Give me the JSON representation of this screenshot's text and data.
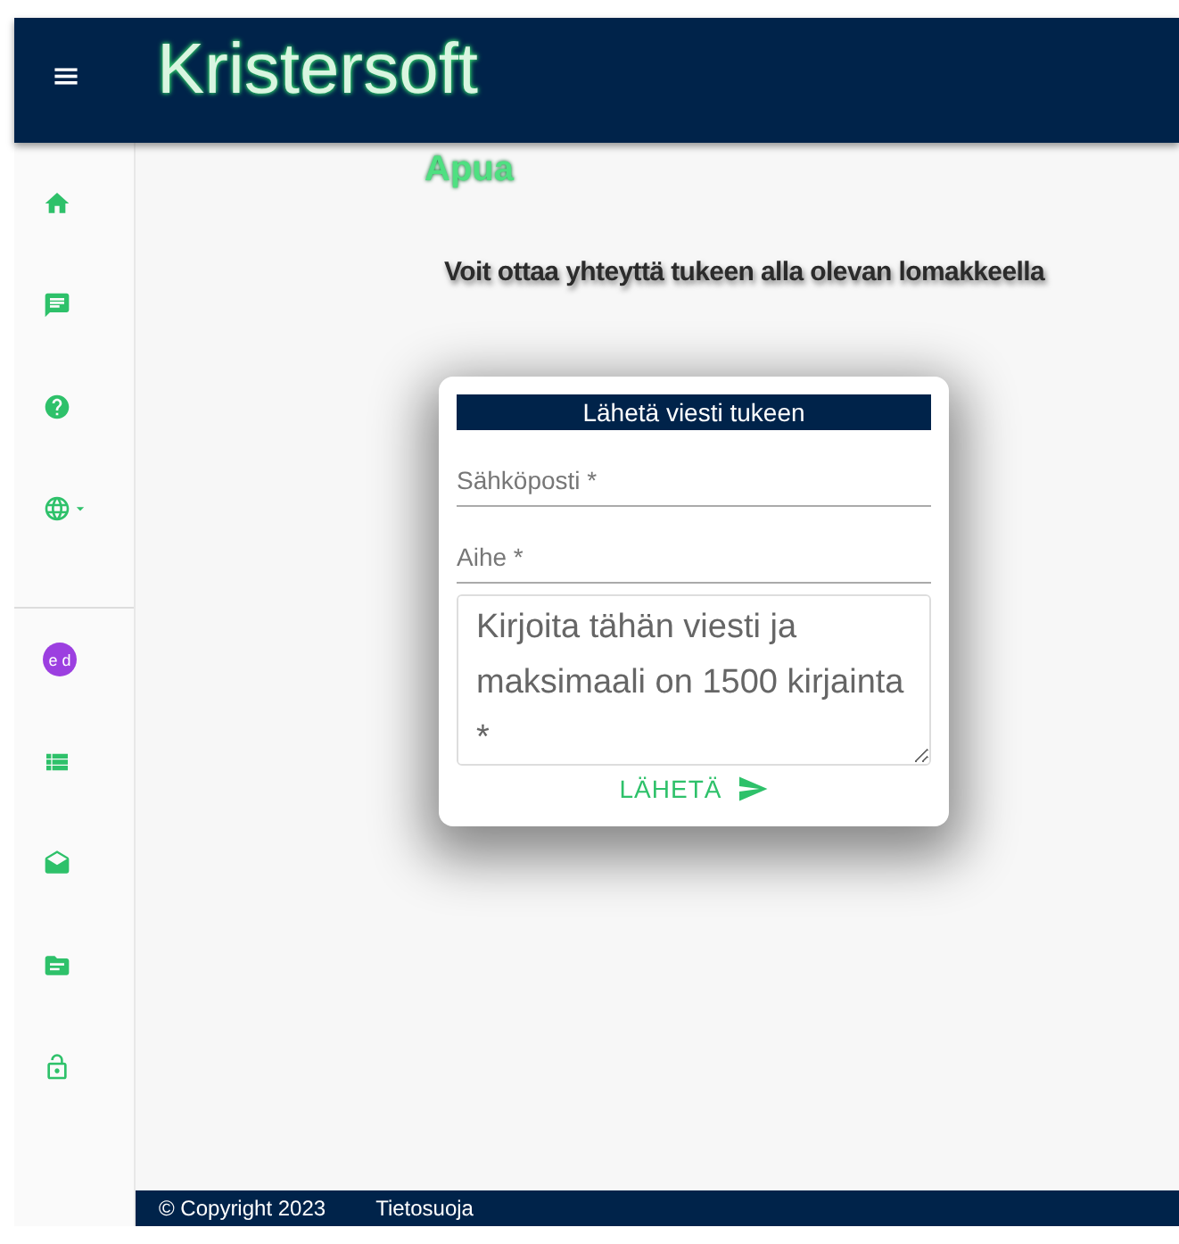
{
  "header": {
    "menu_glyph": "≡",
    "brand": "Kristersoft"
  },
  "sidebar": {
    "items": [
      {
        "kind": "home"
      },
      {
        "kind": "chat"
      },
      {
        "kind": "help"
      },
      {
        "kind": "language"
      },
      {
        "kind": "divider"
      },
      {
        "kind": "avatar",
        "initials": "e d",
        "color": "#9c3fe0"
      },
      {
        "kind": "list"
      },
      {
        "kind": "mail"
      },
      {
        "kind": "folder"
      },
      {
        "kind": "lock"
      }
    ]
  },
  "page": {
    "title": "Apua",
    "intro": "Voit ottaa yhteyttä tukeen alla olevan lomakkeella"
  },
  "form": {
    "title": "Lähetä viesti tukeen",
    "fields": [
      {
        "kind": "input",
        "placeholder": "Sähköposti *"
      },
      {
        "kind": "input",
        "placeholder": "Aihe *"
      },
      {
        "kind": "textarea",
        "placeholder": "Kirjoita tähän viesti ja maksimaali on 1500 kirjainta *"
      }
    ],
    "submit": "LÄHETÄ"
  },
  "footer": {
    "copyright": "© Copyright 2023",
    "link": "Tietosuoja"
  }
}
